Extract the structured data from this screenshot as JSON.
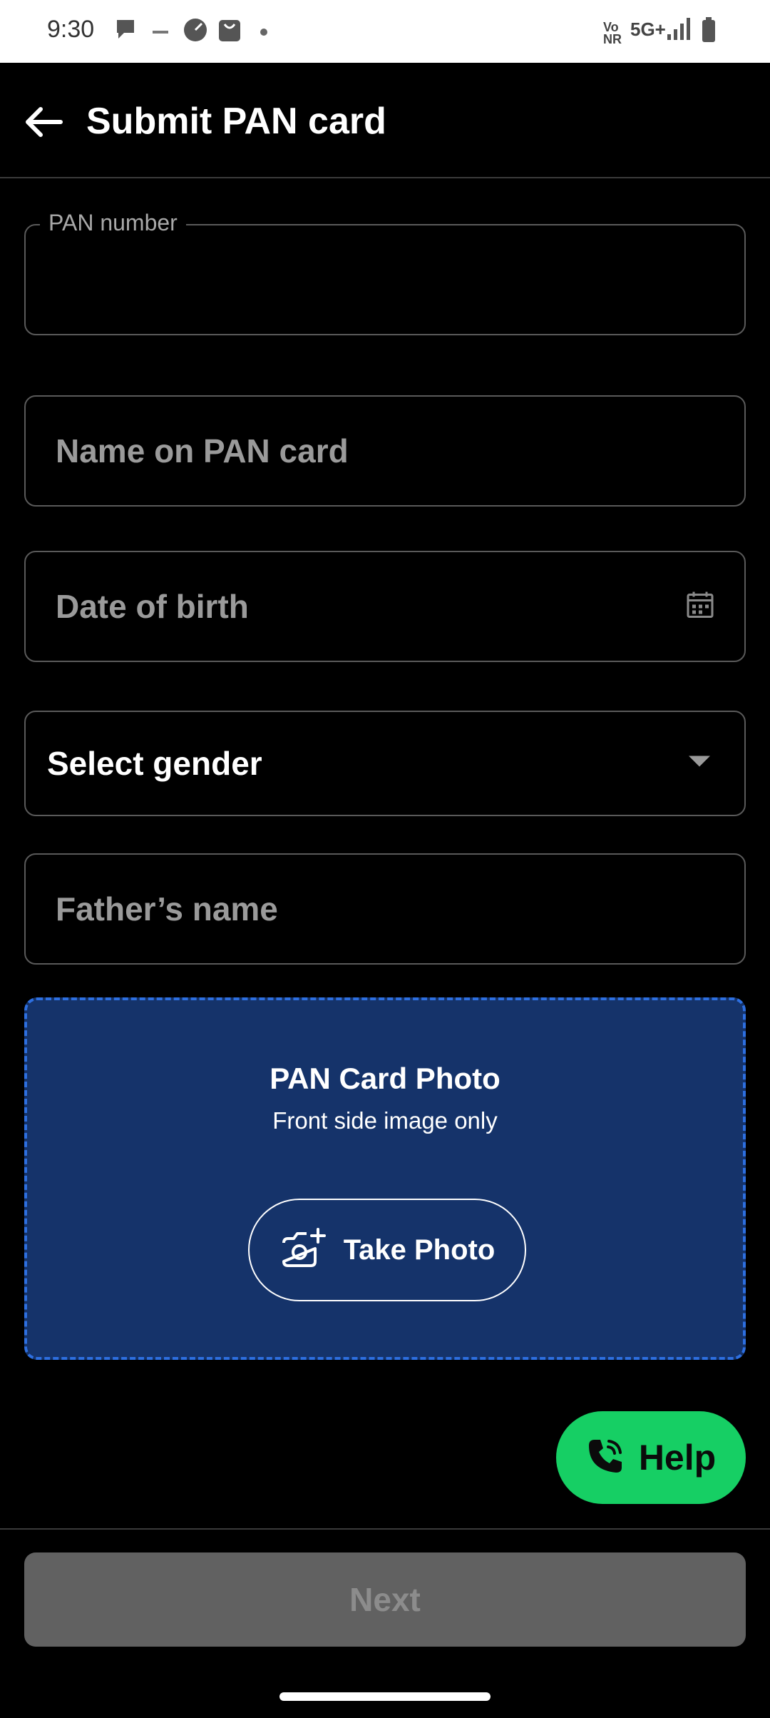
{
  "status_bar": {
    "time": "9:30",
    "network": "5G+",
    "volte": "Vo\nNR",
    "icons": [
      "chat-bubble-icon",
      "small-text-icon",
      "speedometer-icon",
      "shopping-bag-icon",
      "dot-icon",
      "signal-icon",
      "battery-icon"
    ]
  },
  "app_bar": {
    "title": "Submit PAN card",
    "back_icon": "arrow-left-icon"
  },
  "form": {
    "pan_number": {
      "label": "PAN number",
      "value": ""
    },
    "name_on_card": {
      "placeholder": "Name on PAN card"
    },
    "dob": {
      "placeholder": "Date of birth",
      "icon": "calendar-icon"
    },
    "gender": {
      "selected": "Select gender",
      "icon": "dropdown-arrow-icon"
    },
    "father_name": {
      "placeholder": "Father’s name"
    }
  },
  "upload": {
    "title": "PAN Card Photo",
    "subtitle": "Front side image only",
    "button_label": "Take Photo",
    "button_icon": "camera-plus-icon",
    "colors": {
      "background": "#15336a",
      "border": "#2d6fe0"
    }
  },
  "help": {
    "label": "Help",
    "icon": "phone-icon",
    "color": "#16cf64"
  },
  "footer": {
    "next_label": "Next"
  }
}
